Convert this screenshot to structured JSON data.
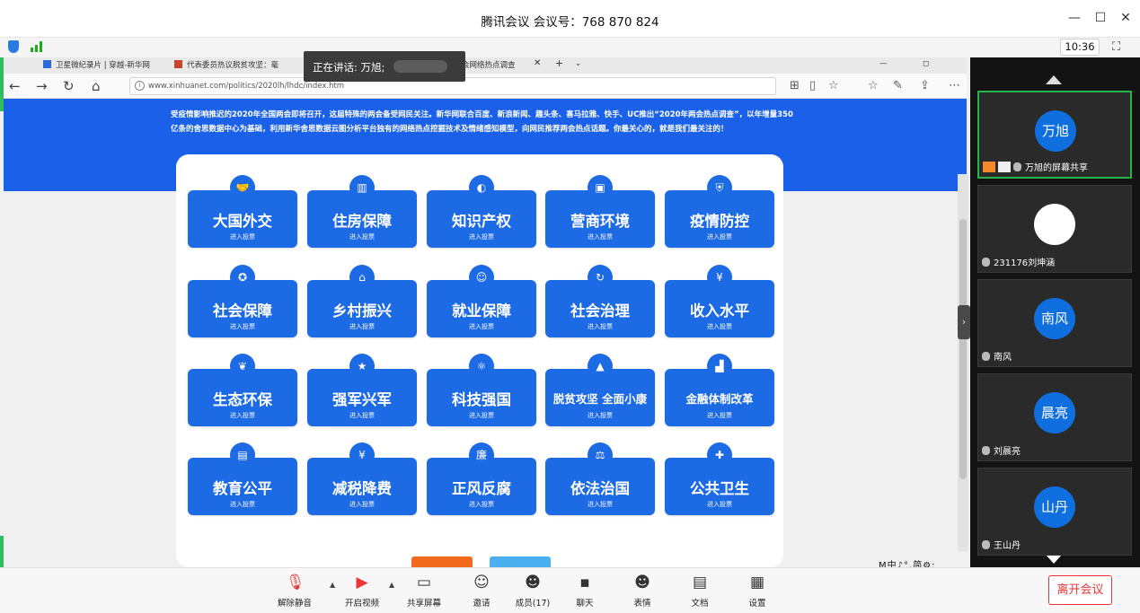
{
  "window": {
    "title": "腾讯会议 会议号：768 870 824",
    "controls": [
      "—",
      "☐",
      "✕"
    ]
  },
  "status": {
    "time": "10:36"
  },
  "speaking": {
    "label": "正在讲话: 万旭;"
  },
  "browser": {
    "tabs": [
      "卫星微纪录片 | 穿越-新华网",
      "代表委员热议脱贫攻坚：毫",
      "会网络热点调查"
    ],
    "url": "www.xinhuanet.com/politics/2020lh/lhdc/index.htm"
  },
  "webpage": {
    "intro": "受疫情影响推迟的2020年全国两会即将召开，这届特殊的两会备受网民关注。新华网联合百度、新浪新闻、趣头条、喜马拉雅、快手、UC推出“2020年两会热点调查”，以年增量350亿条的舍思数据中心为基础，利用新华舍思数据云图分析平台独有的网络热点挖掘技术及情绪感知模型，向网民推荐两会热点话题。你最关心的，就是我们最关注的！",
    "vote_label": "进入投票",
    "topics": [
      {
        "label": "大国外交",
        "icon": "handshake-icon",
        "glyph": "🤝"
      },
      {
        "label": "住房保障",
        "icon": "building-icon",
        "glyph": "▥"
      },
      {
        "label": "知识产权",
        "icon": "ip-icon",
        "glyph": "◐"
      },
      {
        "label": "营商环境",
        "icon": "briefcase-icon",
        "glyph": "▣"
      },
      {
        "label": "疫情防控",
        "icon": "shield-icon",
        "glyph": "⛨"
      },
      {
        "label": "社会保障",
        "icon": "badge-icon",
        "glyph": "✪"
      },
      {
        "label": "乡村振兴",
        "icon": "house-icon",
        "glyph": "⌂"
      },
      {
        "label": "就业保障",
        "icon": "person-icon",
        "glyph": "☺"
      },
      {
        "label": "社会治理",
        "icon": "cycle-icon",
        "glyph": "↻"
      },
      {
        "label": "收入水平",
        "icon": "yuan-icon",
        "glyph": "¥"
      },
      {
        "label": "生态环保",
        "icon": "leaf-icon",
        "glyph": "❦"
      },
      {
        "label": "强军兴军",
        "icon": "star-icon",
        "glyph": "★"
      },
      {
        "label": "科技强国",
        "icon": "atom-icon",
        "glyph": "⚛"
      },
      {
        "label": "脱贫攻坚 全面小康",
        "icon": "mountain-icon",
        "glyph": "▲"
      },
      {
        "label": "金融体制改革",
        "icon": "bank-icon",
        "glyph": "▟"
      },
      {
        "label": "教育公平",
        "icon": "book-icon",
        "glyph": "▤"
      },
      {
        "label": "减税降费",
        "icon": "coin-icon",
        "glyph": "¥"
      },
      {
        "label": "正风反腐",
        "icon": "seal-icon",
        "glyph": "廉"
      },
      {
        "label": "依法治国",
        "icon": "gavel-icon",
        "glyph": "⚖"
      },
      {
        "label": "公共卫生",
        "icon": "firstaid-icon",
        "glyph": "✚"
      }
    ],
    "ime": "M中♪°,简⚙:"
  },
  "participants": [
    {
      "name": "万旭的屏幕共享",
      "avatar": "万旭",
      "active": true
    },
    {
      "name": "231176刘坤涵",
      "avatar": "",
      "active": false
    },
    {
      "name": "南风",
      "avatar": "南风",
      "active": false
    },
    {
      "name": "刘晨亮",
      "avatar": "晨亮",
      "active": false
    },
    {
      "name": "王山丹",
      "avatar": "山丹",
      "active": false
    }
  ],
  "toolbar": {
    "unmute": "解除静音",
    "video": "开启视频",
    "share": "共享屏幕",
    "invite": "邀请",
    "members": "成员(17)",
    "chat": "聊天",
    "emoji": "表情",
    "docs": "文档",
    "settings": "设置",
    "leave": "离开会议"
  },
  "colors": {
    "accent": "#1d6ae5",
    "banner": "#1b60e8",
    "leave": "#e33333",
    "active_border": "#27b449"
  }
}
